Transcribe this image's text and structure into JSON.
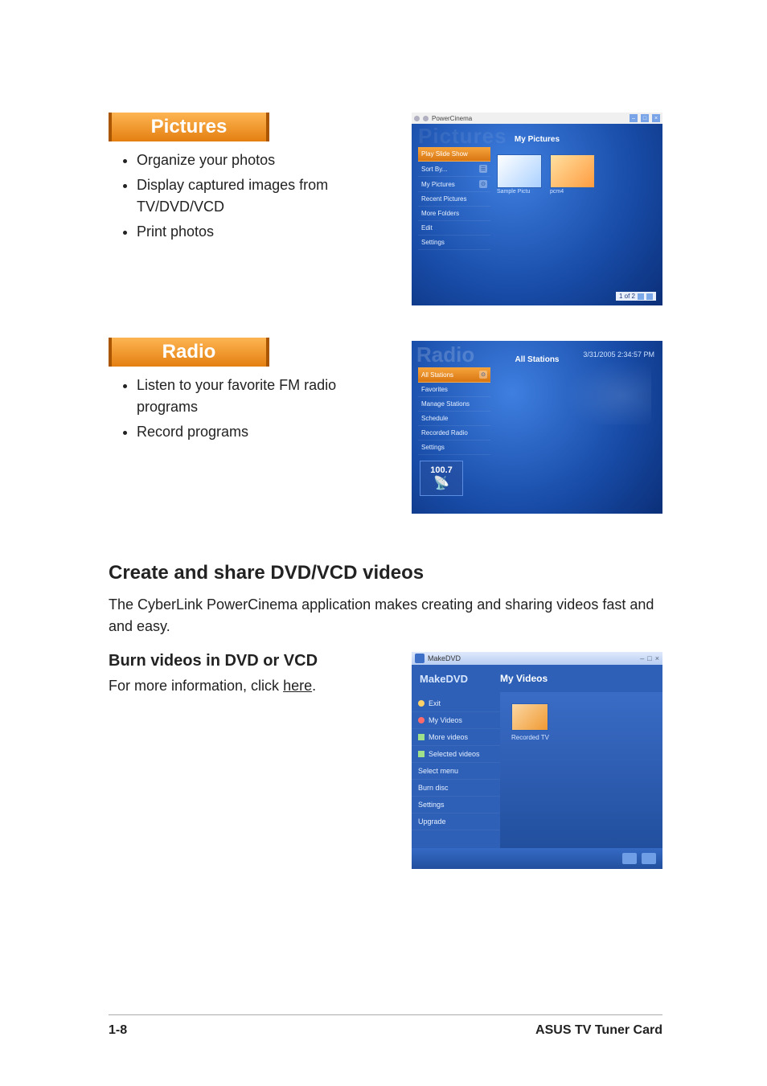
{
  "pictures": {
    "heading": "Pictures",
    "items": [
      "Organize your photos",
      "Display captured images from TV/DVD/VCD",
      "Print photos"
    ],
    "screenshot": {
      "titlebar_app": "PowerCinema",
      "ghost": "Pictures",
      "subtitle": "My Pictures",
      "menu": [
        {
          "label": "Play Slide Show",
          "selected": true
        },
        {
          "label": "Sort By...",
          "chip": "☰"
        },
        {
          "label": "My Pictures",
          "chip": "⊙"
        },
        {
          "label": "Recent Pictures"
        },
        {
          "label": "More Folders"
        },
        {
          "label": "Edit"
        },
        {
          "label": "Settings"
        }
      ],
      "thumb_labels": [
        "Sample Pictu",
        "pcm4"
      ],
      "watermark": "PowerCinema",
      "pager": "1 of 2"
    }
  },
  "radio": {
    "heading": "Radio",
    "items": [
      "Listen to your favorite FM radio programs",
      "Record programs"
    ],
    "screenshot": {
      "ghost": "Radio",
      "datetime": "3/31/2005 2:34:57 PM",
      "subtitle": "All Stations",
      "menu": [
        {
          "label": "All Stations",
          "selected": true,
          "chip": "⊙"
        },
        {
          "label": "Favorites"
        },
        {
          "label": "Manage Stations"
        },
        {
          "label": "Schedule"
        },
        {
          "label": "Recorded Radio"
        },
        {
          "label": "Settings"
        }
      ],
      "frequency": "100.7"
    }
  },
  "dvd_section": {
    "heading": "Create and share DVD/VCD videos",
    "body": "The CyberLink PowerCinema application makes creating and sharing videos fast and and easy.",
    "subhead": "Burn videos in DVD or VCD",
    "info_prefix": "For more information, click ",
    "info_link": "here",
    "info_suffix": ".",
    "screenshot": {
      "titlebar": "MakeDVD",
      "brand": "MakeDVD",
      "section": "My Videos",
      "nav": [
        {
          "label": "Exit",
          "icon": "ico-back"
        },
        {
          "label": "My Videos",
          "icon": "ico-disc"
        },
        {
          "label": "More videos",
          "icon": "ico-sq"
        },
        {
          "label": "Selected videos",
          "icon": "ico-sq"
        },
        {
          "label": "Select menu"
        },
        {
          "label": "Burn disc"
        },
        {
          "label": "Settings"
        },
        {
          "label": "Upgrade"
        }
      ],
      "thumb_label": "Recorded TV"
    }
  },
  "footer": {
    "page": "1-8",
    "product": "ASUS TV Tuner Card"
  }
}
